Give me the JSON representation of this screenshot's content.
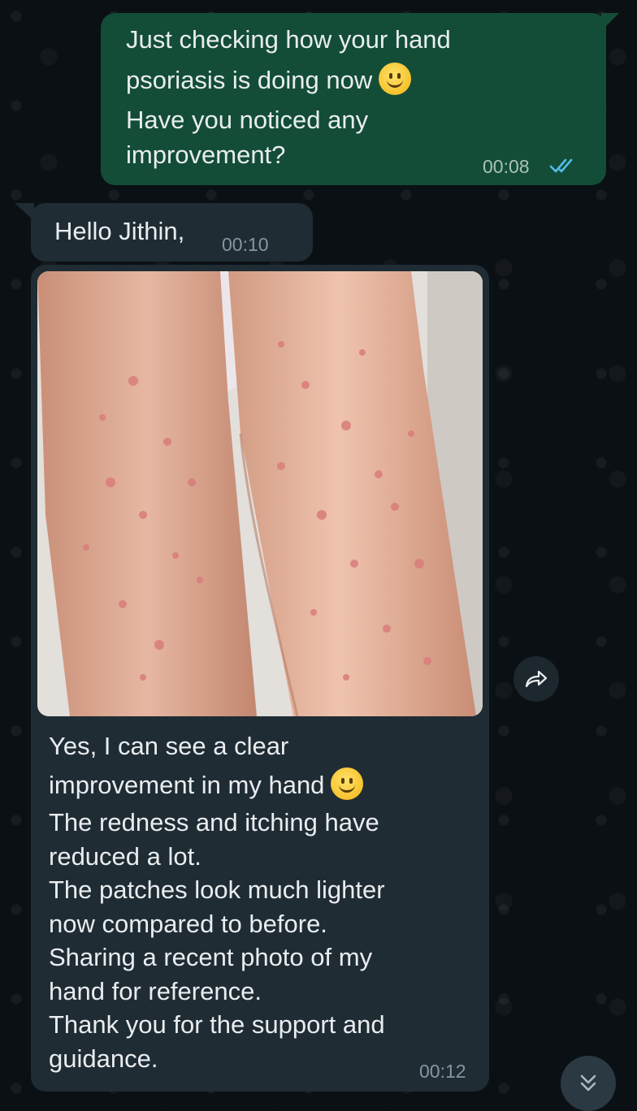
{
  "chat": {
    "messages": [
      {
        "direction": "outgoing",
        "lines": [
          "Just checking how your hand",
          "psoriasis is doing now",
          "Have you noticed any",
          "improvement?"
        ],
        "emoji": "slightly-smiling-face",
        "time": "00:08",
        "status": "read"
      },
      {
        "direction": "incoming",
        "lines": [
          "Hello Jithin,"
        ],
        "time": "00:10"
      },
      {
        "direction": "incoming",
        "has_image": true,
        "image_subject": "photo-of-arms-with-red-spots",
        "lines": [
          "Yes, I can see a clear",
          "improvement in my hand",
          "The redness and itching have",
          "reduced a lot.",
          "The patches look much lighter",
          "now compared to before.",
          "Sharing a recent photo of my",
          "hand for reference.",
          "Thank you for the support and",
          "guidance."
        ],
        "emoji": "slightly-smiling-face",
        "time": "00:12"
      }
    ]
  },
  "colors": {
    "background": "#0b1014",
    "outgoing_bubble": "#134d37",
    "incoming_bubble": "#1f2c34",
    "read_ticks": "#53bdeb",
    "text": "#e9edef"
  },
  "icons": {
    "read_receipt": "double-check-icon",
    "forward": "forward-icon",
    "scroll_down": "double-chevron-down-icon"
  }
}
